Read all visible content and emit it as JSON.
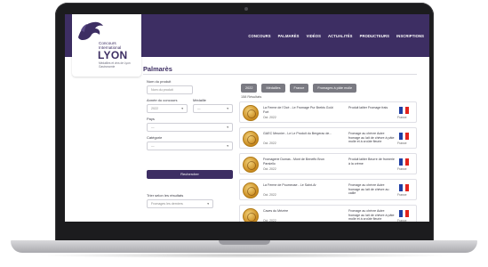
{
  "header": {
    "logo": {
      "line1": "Concours",
      "line2": "International",
      "city": "LYON",
      "tagline": "Médailles et vins de Lyon Gastronomie"
    },
    "nav": [
      "CONCOURS",
      "PALMARÈS",
      "VIDÉOS",
      "ACTUALITÉS",
      "PRODUCTEURS",
      "INSCRIPTIONS"
    ]
  },
  "page": {
    "title": "Palmarès"
  },
  "filters": {
    "product_label": "Nom du produit",
    "product_placeholder": "Nom du produit",
    "year_label": "Année du concours",
    "year_value": "2022",
    "medal_label": "Médaille",
    "medal_value": "—",
    "country_label": "Pays",
    "country_value": "—",
    "category_label": "Catégorie",
    "category_value": "—",
    "search_button": "Rechercher",
    "sort_label": "Trier selon les résultats",
    "sort_value": "Fromages les derniers"
  },
  "chips": [
    "2022",
    "Médailles",
    "France",
    "Fromages à pâte molle"
  ],
  "result_count": "158 Résultats",
  "results": [
    {
      "title": "La Ferme de l'Océ - Le Fromage Pur Brebis Goût Fort",
      "date": "Oct. 2022",
      "category": "Produit laitier Fromage frais",
      "country": "France",
      "flag": [
        "#1f3fa3",
        "#ffffff",
        "#e1241d"
      ]
    },
    {
      "title": "GAEC Meunier - Le Le Produit du Bergerac de...",
      "date": "Oct. 2022",
      "category": "Fromage au chèvre Autre fromage au lait de chèvre à pâte molle et à croûte fleurie",
      "country": "France",
      "flag": [
        "#1f3fa3",
        "#ffffff",
        "#e1241d"
      ]
    },
    {
      "title": "Fromagerie Dumas - Mont de Beneffo Brun Parsiello",
      "date": "Oct. 2022",
      "category": "Produit laitier Beurre de fromerie à la crème",
      "country": "France",
      "flag": [
        "#1f3fa3",
        "#ffffff",
        "#e1241d"
      ]
    },
    {
      "title": "La Ferme de Poumeuse - Le Saint-Ar",
      "date": "Oct. 2022",
      "category": "Fromage au chèvre Autre fromage au lait de chèvre au caillé",
      "country": "France",
      "flag": [
        "#1f3fa3",
        "#ffffff",
        "#e1241d"
      ]
    },
    {
      "title": "Caves du Mézére",
      "date": "Oct. 2022",
      "category": "Fromage au chèvre Autre fromage au lait de chèvre à pâte molle et à croûte fleurie",
      "country": "France",
      "flag": [
        "#1f3fa3",
        "#ffffff",
        "#e1241d"
      ]
    }
  ],
  "colors": {
    "brand": "#3d2e63",
    "chip": "#7a7a82",
    "medal": "#d9a13a"
  }
}
